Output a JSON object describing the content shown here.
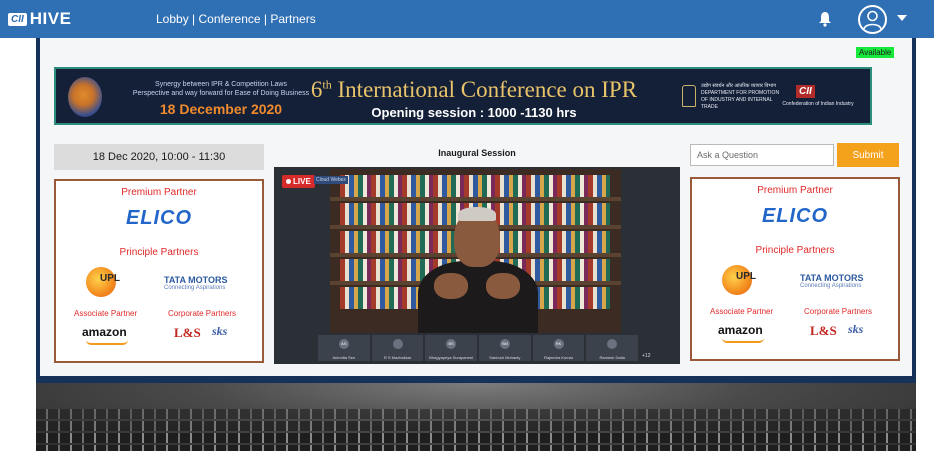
{
  "app": {
    "logo_small": "CII",
    "logo_main": "HIVE",
    "nav": [
      "Lobby",
      "Conference",
      "Partners"
    ],
    "nav_separator": " | "
  },
  "header_icons": [
    "bell-icon",
    "user-avatar-icon",
    "chevron-down-icon"
  ],
  "status": {
    "available": "Available",
    "available_color": "#17e83c"
  },
  "banner": {
    "tagline_1": "Synergy between IPR & Competition Laws",
    "tagline_2": "Perspective and way forward for Ease of Doing Business",
    "date": "18 December 2020",
    "title_num": "6",
    "title_sup": "th",
    "title_rest": " International Conference on IPR",
    "subtitle": "Opening session : 1000 -1130 hrs",
    "dept": "DEPARTMENT FOR PROMOTION OF INDUSTRY AND INTERNAL TRADE",
    "dept_hindi": "उद्योग संवर्धन और आंतरिक व्यापार विभाग",
    "cii": "CII",
    "cii_full": "Confederation of Indian Industry"
  },
  "session": {
    "time": "18 Dec 2020, 10:00 - 11:30",
    "title": "Inaugural Session",
    "live_label": "LIVE",
    "platform": "Cloud Webex"
  },
  "participants": [
    {
      "initials": "AS",
      "name": "Anindita Sen"
    },
    {
      "initials": "",
      "name": "R S Mazhakkar"
    },
    {
      "initials": "BS",
      "name": "Bhagyapriya Surapaneni"
    },
    {
      "initials": "SM",
      "name": "Santosh Mohanty"
    },
    {
      "initials": "RK",
      "name": "Rajendra Kumar"
    },
    {
      "initials": "",
      "name": "Ramesh Datla"
    }
  ],
  "participants_more": "+12",
  "question": {
    "placeholder": "Ask a Question",
    "submit_label": "Submit"
  },
  "partners": {
    "premium_label": "Premium Partner",
    "premium": "ELICO",
    "principle_label": "Principle Partners",
    "upl": "UPL",
    "tata": "TATA MOTORS",
    "tata_sub": "Connecting Aspirations",
    "associate_label": "Associate Partner",
    "corporate_label": "Corporate Partners",
    "amazon": "amazon",
    "lt": "L&S",
    "sks": "sks"
  }
}
